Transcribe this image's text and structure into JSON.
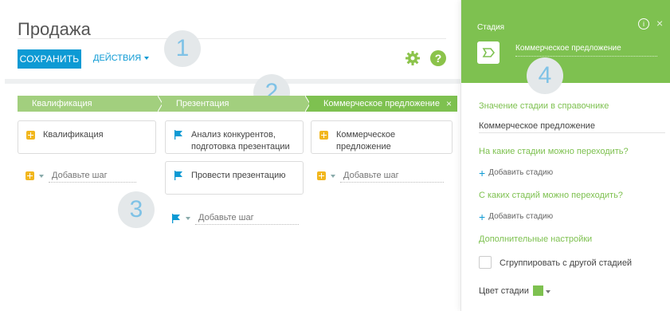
{
  "page": {
    "title": "Продажа"
  },
  "toolbar": {
    "save_label": "СОХРАНИТЬ",
    "actions_label": "ДЕЙСТВИЯ"
  },
  "callouts": [
    "1",
    "2",
    "3",
    "4"
  ],
  "stages": [
    {
      "name": "Квалификация"
    },
    {
      "name": "Презентация"
    },
    {
      "name": "Коммерческое предложение",
      "close": "×"
    }
  ],
  "steps": {
    "col1": [
      "Квалификация"
    ],
    "col2": [
      "Анализ конкурентов, подготовка презентации",
      "Провести презентацию"
    ],
    "col3": [
      "Коммерческое предложение"
    ]
  },
  "add_step_placeholder": "Добавьте шаг",
  "panel": {
    "title": "Стадия",
    "info": "i",
    "close": "×",
    "stage_name": "Коммерческое предложение",
    "lookup_label": "Значение стадии в справочнике",
    "lookup_value": "Коммерческое предложение",
    "to_label": "На какие стадии можно переходить?",
    "from_label": "С каких стадий можно переходить?",
    "add_stage": "Добавить стадию",
    "add_plus": "+",
    "extra_label": "Дополнительные настройки",
    "group_label": "Сгруппировать с другой стадией",
    "color_label": "Цвет стадии",
    "stage_color": "#7ec150"
  },
  "colors": {
    "accent": "#0d9ad4",
    "green": "#7ec150",
    "green_light": "#a2cf7e",
    "step_icon": "#f2b71e"
  }
}
